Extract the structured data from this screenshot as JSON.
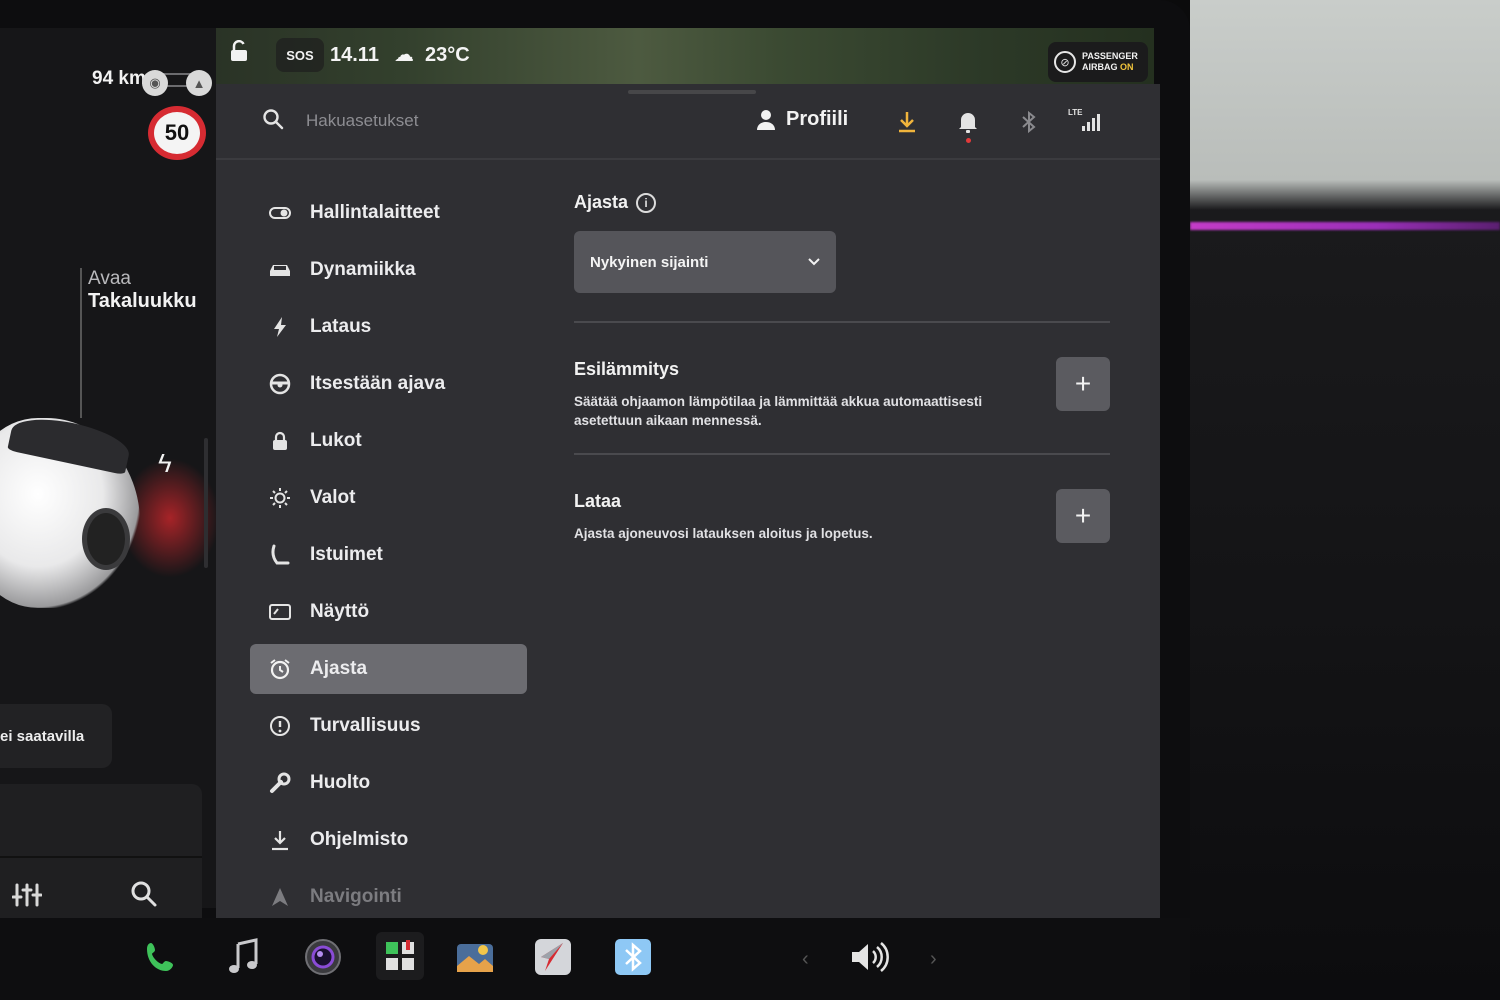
{
  "car": {
    "range": "94 km",
    "speed_limit": "50",
    "trunk_line1": "Avaa",
    "trunk_line2": "Takaluukku",
    "status_text": "ei saatavilla"
  },
  "status_bar": {
    "sos": "SOS",
    "time": "14.11",
    "temperature": "23°C",
    "airbag_line1": "PASSENGER",
    "airbag_line2": "AIRBAG",
    "airbag_state": "ON"
  },
  "header": {
    "search_placeholder": "Hakuasetukset",
    "profile_label": "Profiili",
    "network": "LTE"
  },
  "sidebar": {
    "items": [
      {
        "label": "Hallintalaitteet",
        "icon": "toggle-icon"
      },
      {
        "label": "Dynamiikka",
        "icon": "car-icon"
      },
      {
        "label": "Lataus",
        "icon": "bolt-icon"
      },
      {
        "label": "Itsestään ajava",
        "icon": "steering-wheel-icon"
      },
      {
        "label": "Lukot",
        "icon": "lock-icon"
      },
      {
        "label": "Valot",
        "icon": "sun-icon"
      },
      {
        "label": "Istuimet",
        "icon": "seat-icon"
      },
      {
        "label": "Näyttö",
        "icon": "display-icon"
      },
      {
        "label": "Ajasta",
        "icon": "alarm-icon"
      },
      {
        "label": "Turvallisuus",
        "icon": "alert-circle-icon"
      },
      {
        "label": "Huolto",
        "icon": "wrench-icon"
      },
      {
        "label": "Ohjelmisto",
        "icon": "download-icon"
      },
      {
        "label": "Navigointi",
        "icon": "navigation-icon"
      }
    ],
    "active": "Ajasta"
  },
  "content": {
    "section_title": "Ajasta",
    "location_dropdown": "Nykyinen sijainti",
    "rows": [
      {
        "title": "Esilämmitys",
        "description": "Säätää ohjaamon lämpötilaa ja lämmittää akkua automaattisesti asetettuun aikaan mennessä."
      },
      {
        "title": "Lataa",
        "description": "Ajasta ajoneuvosi latauksen aloitus ja lopetus."
      }
    ]
  },
  "dock": {
    "apps": [
      "phone-icon",
      "music-icon",
      "camera-icon",
      "toybox-icon",
      "photos-icon",
      "navigation-app-icon",
      "bluetooth-icon"
    ],
    "volume": "volume-icon"
  },
  "colors": {
    "panel": "#2f2f33",
    "active_item": "#6c6c71",
    "accent_download": "#f0b43c",
    "speed_ring": "#d62b32"
  }
}
